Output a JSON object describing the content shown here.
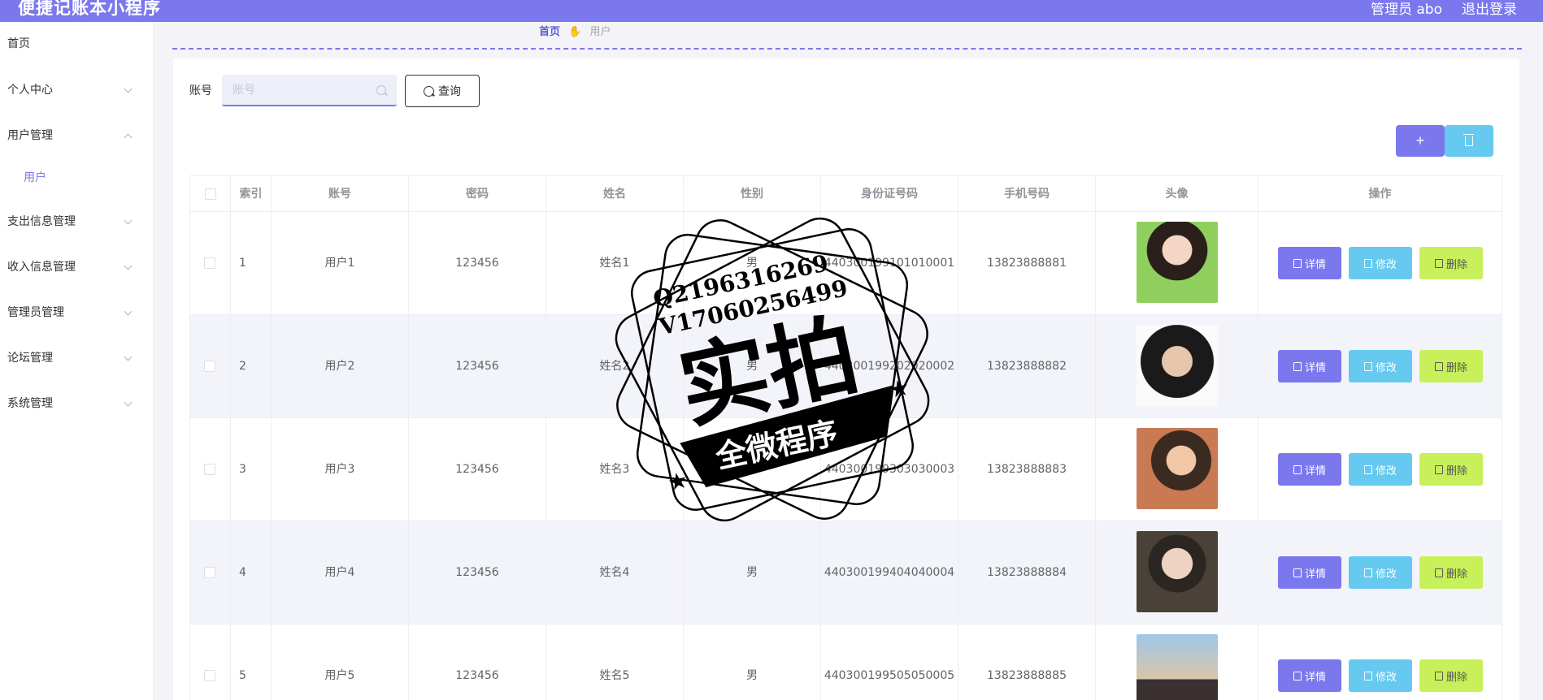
{
  "header": {
    "app_title": "便捷记账本小程序",
    "admin_label": "管理员 abo",
    "logout_label": "退出登录"
  },
  "sidebar": {
    "items": [
      {
        "label": "首页"
      },
      {
        "label": "个人中心"
      },
      {
        "label": "用户管理"
      },
      {
        "label": "用户"
      },
      {
        "label": "支出信息管理"
      },
      {
        "label": "收入信息管理"
      },
      {
        "label": "管理员管理"
      },
      {
        "label": "论坛管理"
      },
      {
        "label": "系统管理"
      }
    ]
  },
  "breadcrumb": {
    "home": "首页",
    "separator_icon": "hand-icon",
    "current": "用户"
  },
  "search": {
    "label": "账号",
    "placeholder": "账号",
    "value": "",
    "button_label": "查询"
  },
  "toolbar": {
    "add_label": "+",
    "colors": {
      "add": "#7b78ee",
      "delete": "#65c9f0"
    }
  },
  "table": {
    "headers": [
      "索引",
      "账号",
      "密码",
      "姓名",
      "性别",
      "身份证号码",
      "手机号码",
      "头像",
      "操作"
    ],
    "rows": [
      {
        "index": "1",
        "account": "用户1",
        "password": "123456",
        "name": "姓名1",
        "gender": "男",
        "id_number": "440300199101010001",
        "phone": "13823888881"
      },
      {
        "index": "2",
        "account": "用户2",
        "password": "123456",
        "name": "姓名2",
        "gender": "男",
        "id_number": "440300199202020002",
        "phone": "13823888882"
      },
      {
        "index": "3",
        "account": "用户3",
        "password": "123456",
        "name": "姓名3",
        "gender": "男",
        "id_number": "440300199303030003",
        "phone": "13823888883"
      },
      {
        "index": "4",
        "account": "用户4",
        "password": "123456",
        "name": "姓名4",
        "gender": "男",
        "id_number": "440300199404040004",
        "phone": "13823888884"
      },
      {
        "index": "5",
        "account": "用户5",
        "password": "123456",
        "name": "姓名5",
        "gender": "男",
        "id_number": "440300199505050005",
        "phone": "13823888885"
      }
    ],
    "actions": {
      "detail": "详情",
      "edit": "修改",
      "delete": "删除"
    }
  },
  "watermark": {
    "line1": "Q2196316269",
    "line2": "V17060256499",
    "main": "实拍",
    "banner": "全微程序"
  }
}
